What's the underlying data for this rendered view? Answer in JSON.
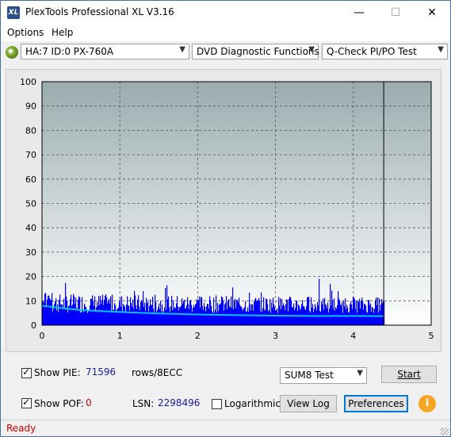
{
  "window": {
    "title": "PlexTools Professional XL V3.16",
    "app_icon_text": "XL"
  },
  "titlebar_buttons": {
    "minimize": "—",
    "maximize": "☐",
    "close": "✕"
  },
  "menu": [
    {
      "label": "Options"
    },
    {
      "label": "Help"
    }
  ],
  "toolbar": {
    "drive": "HA:7 ID:0  PX-760A",
    "function": "DVD Diagnostic Functions",
    "test": "Q-Check PI/PO Test"
  },
  "chart_data": {
    "type": "bar",
    "x_ticks": [
      "0",
      "1",
      "2",
      "3",
      "4",
      "5"
    ],
    "y_ticks": [
      "0",
      "10",
      "20",
      "30",
      "40",
      "50",
      "60",
      "70",
      "80",
      "90",
      "100"
    ],
    "xlim": [
      0,
      5
    ],
    "ylim": [
      0,
      100
    ],
    "grid": true,
    "data_end_x": 4.39,
    "series": [
      {
        "kind": "pie_bars",
        "color": "#0000ff",
        "typical_range": [
          5,
          16
        ],
        "peak": 23
      },
      {
        "kind": "average_line",
        "color": "#00c8ff",
        "x": [
          0,
          0.2,
          0.5,
          1.0,
          1.5,
          2.0,
          2.5,
          3.0,
          3.5,
          4.0,
          4.39
        ],
        "y": [
          8,
          7.2,
          6.2,
          5.4,
          4.8,
          4.4,
          4.1,
          3.9,
          3.8,
          3.8,
          3.7
        ]
      }
    ],
    "colors": {
      "plot_top": "#9aacae",
      "plot_bottom": "#ffffff",
      "grid": "#555555"
    }
  },
  "controls": {
    "show_pie_label": "Show PIE:",
    "pie_value": "71596",
    "rows_label": "rows/8ECC",
    "show_pof_label": "Show POF:",
    "pof_value": "0",
    "lsn_label": "LSN:",
    "lsn_value": "2298496",
    "logarithmic_label": "Logarithmic",
    "sum8_select": "SUM8 Test",
    "start_label": "Start",
    "view_log_label": "View Log",
    "preferences_label": "Preferences",
    "info_icon": "i"
  },
  "status": {
    "text": "Ready"
  }
}
